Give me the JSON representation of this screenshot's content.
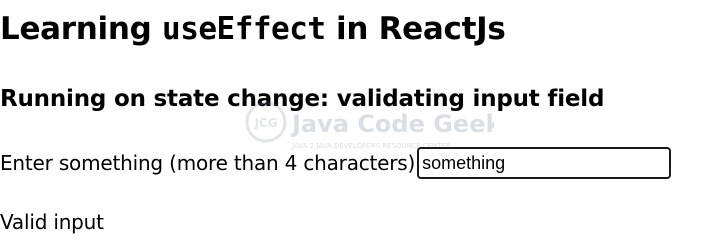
{
  "heading": {
    "prefix": "Learning ",
    "code": "useEffect",
    "suffix": " in ReactJs"
  },
  "subheading": "Running on state change: validating input field",
  "input": {
    "label": "Enter something (more than 4 characters)",
    "value": "something"
  },
  "status_text": "Valid input",
  "watermark": {
    "logo_text": "JCG",
    "brand": "Java Code Geeks",
    "tagline": "JAVA 2 JAVA DEVELOPERS RESOURCE CENTER"
  }
}
